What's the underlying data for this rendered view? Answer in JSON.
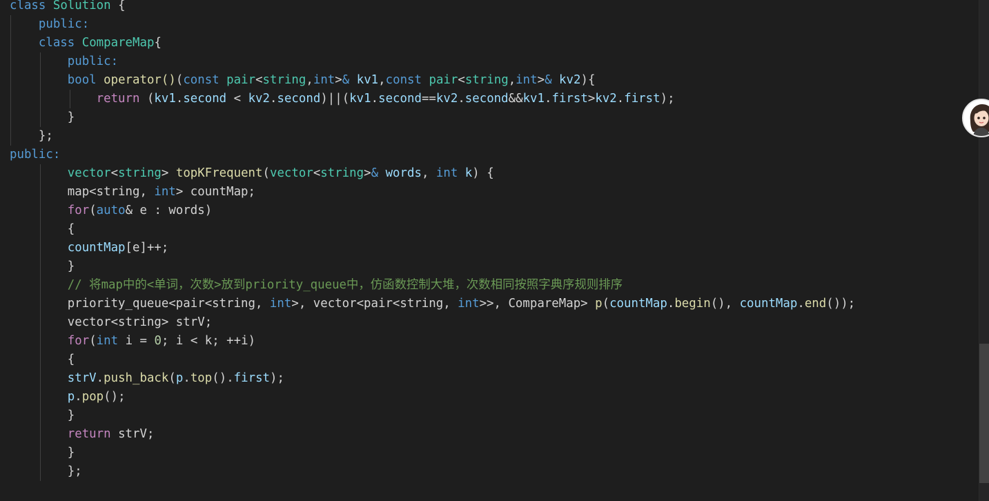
{
  "editor": {
    "lines": [
      [
        {
          "c": "kw",
          "t": "class"
        },
        {
          "c": "pl",
          "t": " "
        },
        {
          "c": "ty",
          "t": "Solution"
        },
        {
          "c": "pl",
          "t": " {"
        }
      ],
      [
        {
          "c": "pl",
          "t": "    "
        },
        {
          "c": "kw",
          "t": "public:"
        }
      ],
      [
        {
          "c": "pl",
          "t": "    "
        },
        {
          "c": "kw",
          "t": "class"
        },
        {
          "c": "pl",
          "t": " "
        },
        {
          "c": "ty",
          "t": "CompareMap"
        },
        {
          "c": "pl",
          "t": "{"
        }
      ],
      [
        {
          "c": "pl",
          "t": "        "
        },
        {
          "c": "kw",
          "t": "public:"
        }
      ],
      [
        {
          "c": "pl",
          "t": "        "
        },
        {
          "c": "kw",
          "t": "bool"
        },
        {
          "c": "pl",
          "t": " "
        },
        {
          "c": "fn",
          "t": "operator()"
        },
        {
          "c": "pl",
          "t": "("
        },
        {
          "c": "kw",
          "t": "const"
        },
        {
          "c": "pl",
          "t": " "
        },
        {
          "c": "ty",
          "t": "pair"
        },
        {
          "c": "pl",
          "t": "<"
        },
        {
          "c": "ty",
          "t": "string"
        },
        {
          "c": "pl",
          "t": ","
        },
        {
          "c": "kw",
          "t": "int"
        },
        {
          "c": "pl",
          "t": ">"
        },
        {
          "c": "kw",
          "t": "&"
        },
        {
          "c": "pl",
          "t": " "
        },
        {
          "c": "var",
          "t": "kv1"
        },
        {
          "c": "pl",
          "t": ","
        },
        {
          "c": "kw",
          "t": "const"
        },
        {
          "c": "pl",
          "t": " "
        },
        {
          "c": "ty",
          "t": "pair"
        },
        {
          "c": "pl",
          "t": "<"
        },
        {
          "c": "ty",
          "t": "string"
        },
        {
          "c": "pl",
          "t": ","
        },
        {
          "c": "kw",
          "t": "int"
        },
        {
          "c": "pl",
          "t": ">"
        },
        {
          "c": "kw",
          "t": "&"
        },
        {
          "c": "pl",
          "t": " "
        },
        {
          "c": "var",
          "t": "kv2"
        },
        {
          "c": "pl",
          "t": "){"
        }
      ],
      [
        {
          "c": "pl",
          "t": "            "
        },
        {
          "c": "ctl",
          "t": "return"
        },
        {
          "c": "pl",
          "t": " ("
        },
        {
          "c": "var",
          "t": "kv1"
        },
        {
          "c": "pl",
          "t": "."
        },
        {
          "c": "var",
          "t": "second"
        },
        {
          "c": "pl",
          "t": " < "
        },
        {
          "c": "var",
          "t": "kv2"
        },
        {
          "c": "pl",
          "t": "."
        },
        {
          "c": "var",
          "t": "second"
        },
        {
          "c": "pl",
          "t": ")||("
        },
        {
          "c": "var",
          "t": "kv1"
        },
        {
          "c": "pl",
          "t": "."
        },
        {
          "c": "var",
          "t": "second"
        },
        {
          "c": "pl",
          "t": "=="
        },
        {
          "c": "var",
          "t": "kv2"
        },
        {
          "c": "pl",
          "t": "."
        },
        {
          "c": "var",
          "t": "second"
        },
        {
          "c": "pl",
          "t": "&&"
        },
        {
          "c": "var",
          "t": "kv1"
        },
        {
          "c": "pl",
          "t": "."
        },
        {
          "c": "var",
          "t": "first"
        },
        {
          "c": "pl",
          "t": ">"
        },
        {
          "c": "var",
          "t": "kv2"
        },
        {
          "c": "pl",
          "t": "."
        },
        {
          "c": "var",
          "t": "first"
        },
        {
          "c": "pl",
          "t": ");"
        }
      ],
      [
        {
          "c": "pl",
          "t": "        }"
        }
      ],
      [
        {
          "c": "pl",
          "t": "    };"
        }
      ],
      [
        {
          "c": "kw",
          "t": "public:"
        }
      ],
      [
        {
          "c": "pl",
          "t": "        "
        },
        {
          "c": "ty",
          "t": "vector"
        },
        {
          "c": "pl",
          "t": "<"
        },
        {
          "c": "ty",
          "t": "string"
        },
        {
          "c": "pl",
          "t": "> "
        },
        {
          "c": "fn",
          "t": "topKFrequent"
        },
        {
          "c": "pl",
          "t": "("
        },
        {
          "c": "ty",
          "t": "vector"
        },
        {
          "c": "pl",
          "t": "<"
        },
        {
          "c": "ty",
          "t": "string"
        },
        {
          "c": "pl",
          "t": ">"
        },
        {
          "c": "kw",
          "t": "&"
        },
        {
          "c": "pl",
          "t": " "
        },
        {
          "c": "var",
          "t": "words"
        },
        {
          "c": "pl",
          "t": ", "
        },
        {
          "c": "kw",
          "t": "int"
        },
        {
          "c": "pl",
          "t": " "
        },
        {
          "c": "var",
          "t": "k"
        },
        {
          "c": "pl",
          "t": ") {"
        }
      ],
      [
        {
          "c": "pl",
          "t": "        map<string, "
        },
        {
          "c": "kw",
          "t": "int"
        },
        {
          "c": "pl",
          "t": "> countMap;"
        }
      ],
      [
        {
          "c": "pl",
          "t": "        "
        },
        {
          "c": "ctl",
          "t": "for"
        },
        {
          "c": "pl",
          "t": "("
        },
        {
          "c": "kw",
          "t": "auto"
        },
        {
          "c": "pl",
          "t": "& e : words)"
        }
      ],
      [
        {
          "c": "pl",
          "t": "        {"
        }
      ],
      [
        {
          "c": "pl",
          "t": "        "
        },
        {
          "c": "var",
          "t": "countMap"
        },
        {
          "c": "pl",
          "t": "[e]++;"
        }
      ],
      [
        {
          "c": "pl",
          "t": "        }"
        }
      ],
      [
        {
          "c": "pl",
          "t": "        "
        },
        {
          "c": "cm",
          "t": "// 将map中的<单词，次数>放到priority_queue中，仿函数控制大堆，次数相同按照字典序规则排序"
        }
      ],
      [
        {
          "c": "pl",
          "t": "        priority_queue<pair<string, "
        },
        {
          "c": "kw",
          "t": "int"
        },
        {
          "c": "pl",
          "t": ">, vector<pair<string, "
        },
        {
          "c": "kw",
          "t": "int"
        },
        {
          "c": "pl",
          "t": ">>, CompareMap> "
        },
        {
          "c": "fn",
          "t": "p"
        },
        {
          "c": "pl",
          "t": "("
        },
        {
          "c": "var",
          "t": "countMap"
        },
        {
          "c": "pl",
          "t": "."
        },
        {
          "c": "fn",
          "t": "begin"
        },
        {
          "c": "pl",
          "t": "(), "
        },
        {
          "c": "var",
          "t": "countMap"
        },
        {
          "c": "pl",
          "t": "."
        },
        {
          "c": "fn",
          "t": "end"
        },
        {
          "c": "pl",
          "t": "());"
        }
      ],
      [
        {
          "c": "pl",
          "t": "        vector<string> strV;"
        }
      ],
      [
        {
          "c": "pl",
          "t": "        "
        },
        {
          "c": "ctl",
          "t": "for"
        },
        {
          "c": "pl",
          "t": "("
        },
        {
          "c": "kw",
          "t": "int"
        },
        {
          "c": "pl",
          "t": " i = "
        },
        {
          "c": "num",
          "t": "0"
        },
        {
          "c": "pl",
          "t": "; i < k; ++i)"
        }
      ],
      [
        {
          "c": "pl",
          "t": "        {"
        }
      ],
      [
        {
          "c": "pl",
          "t": "        "
        },
        {
          "c": "var",
          "t": "strV"
        },
        {
          "c": "pl",
          "t": "."
        },
        {
          "c": "fn",
          "t": "push_back"
        },
        {
          "c": "pl",
          "t": "("
        },
        {
          "c": "var",
          "t": "p"
        },
        {
          "c": "pl",
          "t": "."
        },
        {
          "c": "fn",
          "t": "top"
        },
        {
          "c": "pl",
          "t": "()."
        },
        {
          "c": "var",
          "t": "first"
        },
        {
          "c": "pl",
          "t": ");"
        }
      ],
      [
        {
          "c": "pl",
          "t": "        "
        },
        {
          "c": "var",
          "t": "p"
        },
        {
          "c": "pl",
          "t": "."
        },
        {
          "c": "fn",
          "t": "pop"
        },
        {
          "c": "pl",
          "t": "();"
        }
      ],
      [
        {
          "c": "pl",
          "t": "        }"
        }
      ],
      [
        {
          "c": "pl",
          "t": "        "
        },
        {
          "c": "ctl",
          "t": "return"
        },
        {
          "c": "pl",
          "t": " strV;"
        }
      ],
      [
        {
          "c": "pl",
          "t": "        }"
        }
      ],
      [
        {
          "c": "pl",
          "t": "        };"
        }
      ]
    ]
  },
  "icons": {
    "avatar": "avatar-icon"
  },
  "colors": {
    "background": "#1e1e1e",
    "keyword": "#569cd6",
    "control": "#c586c0",
    "type": "#4ec9b0",
    "function": "#dcdcaa",
    "variable": "#9cdcfe",
    "number": "#b5cea8",
    "comment": "#6a9955",
    "plain": "#d4d4d4"
  }
}
